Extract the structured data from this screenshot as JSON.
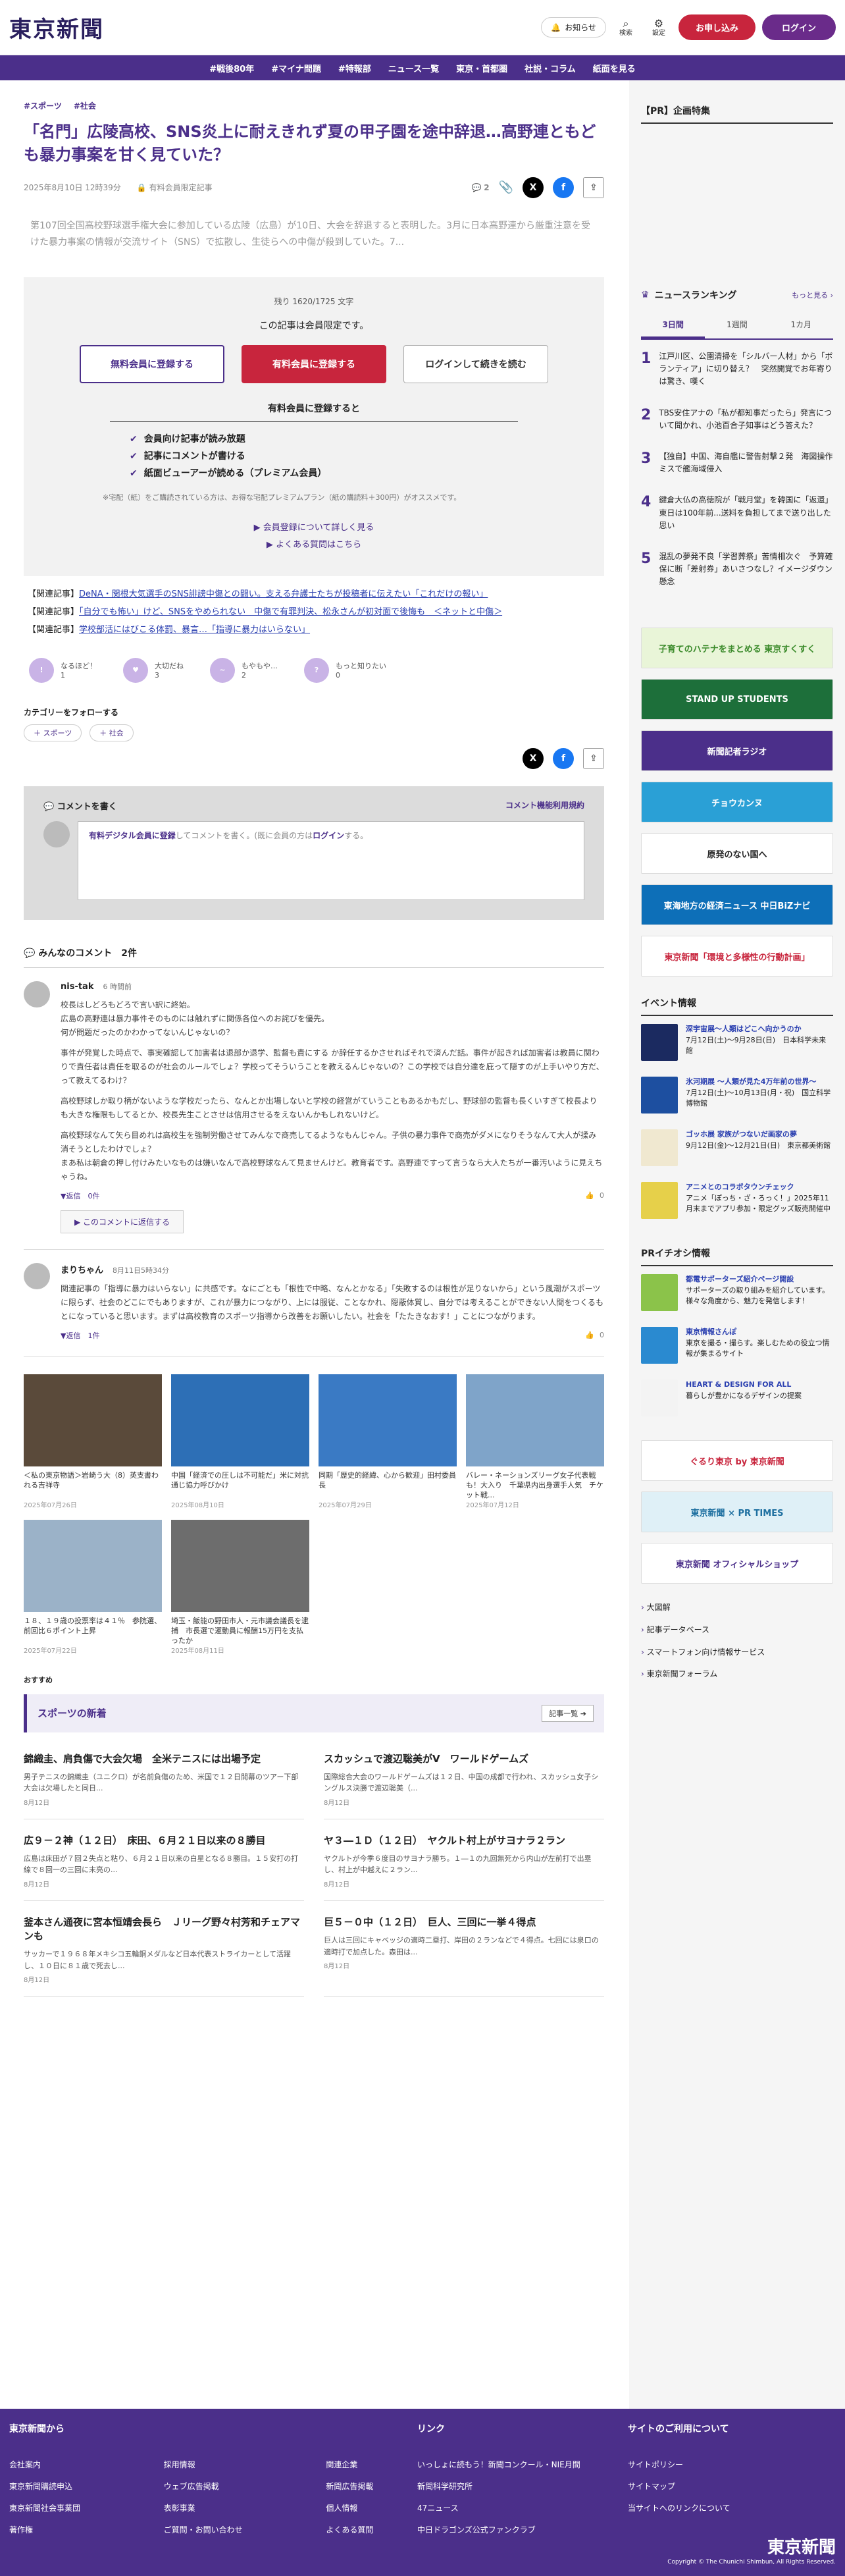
{
  "header": {
    "logo": "東京新聞",
    "notice_label": "お知らせ",
    "search_label": "検索",
    "settings_label": "設定",
    "apply_label": "お申し込み",
    "login_label": "ログイン"
  },
  "nav": [
    "#戦後80年",
    "#マイナ問題",
    "#特報部",
    "ニュース一覧",
    "東京・首都圏",
    "社説・コラム",
    "紙面を見る"
  ],
  "article": {
    "tags": [
      "#スポーツ",
      "#社会"
    ],
    "title": "「名門」広陵高校、SNS炎上に耐えきれず夏の甲子園を途中辞退…高野連ともども暴力事案を甘く見ていた？",
    "date": "2025年8月10日 12時39分",
    "member_label": "有料会員限定記事",
    "comment_count": "2",
    "lead": "第107回全国高校野球選手権大会に参加している広陵（広島）が10日、大会を辞退すると表明した。3月に日本高野連から厳重注意を受けた暴力事案の情報が交流サイト（SNS）で拡散し、生徒らへの中傷が殺到していた。7..."
  },
  "paywall": {
    "remain": "残り 1620/1725 文字",
    "only": "この記事は会員限定です。",
    "free_btn": "無料会員に登録する",
    "paid_btn": "有料会員に登録する",
    "login_btn": "ログインして続きを読む",
    "sub": "有料会員に登録すると",
    "benefits": [
      "会員向け記事が読み放題",
      "記事にコメントが書ける",
      "紙面ビューアーが読める（プレミアム会員）"
    ],
    "note": "※宅配（紙）をご購読されている方は、お得な宅配プレミアムプラン（紙の購読料＋300円）がオススメです。",
    "link1": "会員登録について詳しく見る",
    "link2": "よくある質問はこちら"
  },
  "related": [
    {
      "label": "【関連記事】",
      "text": "DeNA・関根大気選手のSNS誹謗中傷との闘い。支える弁護士たちが投稿者に伝えたい「これだけの報い」"
    },
    {
      "label": "【関連記事】",
      "text": "「自分でも怖い」けど、SNSをやめられない　中傷で有罪判決、松永さんが初対面で後悔も　＜ネットと中傷＞"
    },
    {
      "label": "【関連記事】",
      "text": "学校部活にはびこる体罰、暴言…「指導に暴力はいらない」"
    }
  ],
  "reactions": [
    {
      "label": "なるほど！",
      "count": "1",
      "glyph": "!"
    },
    {
      "label": "大切だね",
      "count": "3",
      "glyph": "♥"
    },
    {
      "label": "もやもや…",
      "count": "2",
      "glyph": "~"
    },
    {
      "label": "もっと知りたい",
      "count": "0",
      "glyph": "?"
    }
  ],
  "follow": {
    "label": "カテゴリーをフォローする",
    "tags": [
      "＋ スポーツ",
      "＋ 社会"
    ]
  },
  "comment_box": {
    "title": "コメントを書く",
    "rules": "コメント機能利用規約",
    "placeholder_pre": "有料デジタル会員に登録",
    "placeholder_mid": "してコメントを書く。(既に会員の方は",
    "placeholder_login": "ログイン",
    "placeholder_end": "する。"
  },
  "comments_header": "みんなのコメント　2件",
  "comments": [
    {
      "name": "nis-tak",
      "time": "6 時間前",
      "paras": [
        "校長はしどろもどろで言い訳に終始。\n広島の高野連は暴力事件そのものには触れずに関係各位へのお詫びを優先。\n何が問題だったのかわかってないんじゃないの？",
        "事件が発覚した時点で、事実確認して加害者は退部か退学、監督も責にする か辞任するかさせればそれで済んだ話。事件が起きれば加害者は教員に関わりで責任者は責任を取るのが社会のルールでしょ？学校ってそういうことを教えるんじゃないの？この学校では自分達を庇って隠すのが上手いやり方だ、って教えてるわけ？",
        "高校野球しか取り柄がないような学校だったら、なんとか出場しないと学校の経営がていうこともあるかもだし、野球部の監督も長くいすぎて校長よりも大きな権限もしてるとか、校長先生ことさせは信用させるをえないんかもしれないけど。",
        "高校野球なんて矢ら目めれは高校生を強制労働させてみんなで商売してるようなもんじゃん。子供の暴力事件で商売がダメになりそうなんて大人が揉み消そうとしたわけでしょ？\nまあ私は朝倉の押し付けみたいなものは嫌いなんで高校野球なんて見ませんけど。教育者です。高野連ですって言うなら大人たちが一番汚いように見えちゃうね。"
      ],
      "replies": "返信　0件",
      "likes": "0",
      "reply_btn": "このコメントに返信する"
    },
    {
      "name": "まりちゃん",
      "time": "8月11日5時34分",
      "paras": [
        "関連記事の「指導に暴力はいらない」に共感です。なにごとも「根性で中略、なんとかなる」「失敗するのは根性が足りないから」という風潮がスポーツに限らず、社会のどこにでもありますが、これが暴力につながり、上には服従、ことなかれ、隠蔽体質し、自分では考えることができない人間をつくるもとになっていると思います。まずは高校教育のスポーツ指導から改善をお願いしたい。社会を「たたきなおす！」ことにつながります。"
      ],
      "replies": "返信　1件",
      "likes": "0"
    }
  ],
  "photos": [
    {
      "cap": "＜私の東京物語＞岩崎う大（8）英支書われる吉祥寺",
      "date": "2025年07月26日",
      "color": "#5a4a3a"
    },
    {
      "cap": "中国「経済での圧しは不可能だ」米に対抗通じ協力呼びかけ",
      "date": "2025年08月10日",
      "color": "#2d6fb6"
    },
    {
      "cap": "同期「歴史的経緯、心から歓迎」田村委員長",
      "date": "2025年07月29日",
      "color": "#3a7ac4"
    },
    {
      "cap": "バレー・ネーションズリーグ女子代表戦も！大入り　千葉県内出身選手人気　チケット戦...",
      "date": "2025年07月12日",
      "color": "#7fa4c9"
    },
    {
      "cap": "１８、１９歳の投票率は４１％　参院選、前回比６ポイント上昇",
      "date": "2025年07月22日",
      "color": "#9bb2c8"
    },
    {
      "cap": "埼玉・飯能の野田市人・元市議会議長を逮捕　市長選で運動員に報酬15万円を支払ったか",
      "date": "2025年08月11日",
      "color": "#6d6d6d"
    }
  ],
  "recommend": "おすすめ",
  "sports": {
    "title": "スポーツの新着",
    "more": "記事一覧",
    "items": [
      {
        "h": "錦織圭、肩負傷で大会欠場　全米テニスには出場予定",
        "p": "男子テニスの錦織圭（ユニクロ）が名前負傷のため、米国で１２日開幕のツアー下部大会は欠場したと同日...",
        "d": "8月12日"
      },
      {
        "h": "スカッシュで渡辺聡美がV　ワールドゲームズ",
        "p": "国際総合大会のワールドゲームズは１２日、中国の成都で行われ、スカッシュ女子シングルス決勝で渡辺聡美（...",
        "d": "8月12日"
      },
      {
        "h": "広９－２神（１２日）　床田、６月２１日以来の８勝目",
        "p": "広島は床田が７回２失点と粘り、６月２１日以来の白星となる８勝目。１５安打の打線で８回一の三回に末亮の...",
        "d": "8月12日"
      },
      {
        "h": "ヤ３―１Ｄ（１２日）　ヤクルト村上がサヨナラ２ラン",
        "p": "ヤクルトが今季６度目のサヨナラ勝ち。１―１の九回無死から内山が左前打で出塁し、村上が中越えに２ラン...",
        "d": "8月12日"
      },
      {
        "h": "釜本さん通夜に宮本恒靖会長ら　Ｊリーグ野々村芳和チェアマンも",
        "p": "サッカーで１９６８年メキシコ五輪銅メダルなど日本代表ストライカーとして活躍し、１０日に８１歳で死去し...",
        "d": "8月12日"
      },
      {
        "h": "巨５－０中（１２日）　巨人、三回に一挙４得点",
        "p": "巨人は三回にキャベッジの適時二塁打、岸田の２ランなどで４得点。七回には泉口の適時打で加点した。森田は...",
        "d": "8月12日"
      }
    ]
  },
  "side": {
    "pr_title": "【PR】企画特集",
    "rank_title": "ニュースランキング",
    "rank_more": "もっと見る",
    "tabs": [
      "3日間",
      "1週間",
      "1カ月"
    ],
    "rank": [
      {
        "n": "1",
        "t": "江戸川区、公園清掃を「シルバー人材」から「ボランティア」に切り替え？　突然開覚でお年寄りは驚き、嘆く"
      },
      {
        "n": "2",
        "t": "TBS安住アナの「私が都知事だったら」発言について聞かれ、小池百合子知事はどう答えた？"
      },
      {
        "n": "3",
        "t": "【独自】中国、海自艦に警告射撃２発　海図操作ミスで艦海域侵入"
      },
      {
        "n": "4",
        "t": "鍵倉大仏の高徳院が「戦月堂」を韓国に「返還」 東日は100年前...送料を負担してまで送り出した思い"
      },
      {
        "n": "5",
        "t": "混乱の夢発不良「学習葬祭」苦情相次ぐ　予算確保に断「差射券」あいさつなし？イメージダウン懸念"
      }
    ],
    "banners": [
      {
        "t": "子育てのハテナをまとめる 東京すくすく",
        "bg": "#e9f5d8",
        "fg": "#3a8a2a"
      },
      {
        "t": "STAND UP STUDENTS",
        "bg": "#1d6f3a",
        "fg": "#fff"
      },
      {
        "t": "新聞記者ラジオ",
        "bg": "#4b2f8a",
        "fg": "#fff"
      },
      {
        "t": "チョウカンヌ",
        "bg": "#2aa0d6",
        "fg": "#fff"
      },
      {
        "t": "原発のない国へ",
        "bg": "#fff",
        "fg": "#222"
      },
      {
        "t": "東海地方の経済ニュース 中日BiZナビ",
        "bg": "#0d6fb8",
        "fg": "#fff"
      },
      {
        "t": "東京新聞「環境と多様性の行動計画」",
        "bg": "#fff",
        "fg": "#c8253d"
      }
    ],
    "event_title": "イベント情報",
    "events": [
      {
        "t": "深宇宙展〜人類はどこへ向かうのか",
        "s": "7月12日(土)〜9月28日(日)　日本科学未来館",
        "color": "#1b2a60"
      },
      {
        "t": "氷河期展 〜人類が見た4万年前の世界〜",
        "s": "7月12日(土)〜10月13日(月・祝)　国立科学博物館",
        "color": "#1d4fa0"
      },
      {
        "t": "ゴッホ展 家族がつないだ画家の夢",
        "s": "9月12日(金)〜12月21日(日)　東京都美術館",
        "color": "#f0e8d0"
      },
      {
        "t": "アニメとのコラボタウンチェック",
        "s": "アニメ「ぽっち・ざ・ろっく！」2025年11月末までアプリ参加・限定グッズ販売開催中",
        "color": "#e6d04a"
      }
    ],
    "pr2_title": "PRイチオシ情報",
    "pr2": [
      {
        "t": "都電サポーターズ紹介ページ開設",
        "s": "サポーターズの取り組みを紹介しています。様々な角度から、魅力を発信します！",
        "color": "#8bc34a"
      },
      {
        "t": "東京情報さんぽ",
        "s": "東京を撮る・撮らす。楽しむための役立つ情報が集まるサイト",
        "color": "#2a8ad0"
      },
      {
        "t": "HEART & DESIGN FOR ALL",
        "s": "暮らしが豊かになるデザインの提案",
        "color": "#f3f3f3"
      }
    ],
    "banners2": [
      {
        "t": "ぐるり東京 by 東京新聞",
        "bg": "#fff",
        "fg": "#c8253d"
      },
      {
        "t": "東京新聞 × PR TIMES",
        "bg": "#dff0f7",
        "fg": "#1d6fa0"
      },
      {
        "t": "東京新聞 オフィシャルショップ",
        "bg": "#fff",
        "fg": "#4b2f8a"
      }
    ],
    "links": [
      "大図解",
      "記事データベース",
      "スマートフォン向け情報サービス",
      "東京新聞フォーラム"
    ]
  },
  "footer": {
    "col1_title": "東京新聞から",
    "col1": [
      "会社案内",
      "東京新聞購読申込",
      "東京新聞社会事業団",
      "著作権",
      "採用情報",
      "ウェブ広告掲載",
      "表彰事業",
      "ご質問・お問い合わせ",
      "関連企業",
      "新聞広告掲載",
      "個人情報",
      "よくある質問"
    ],
    "col2_title": "リンク",
    "col2": [
      "いっしょに読もう！新聞コンクール・NIE月間",
      "新聞科学研究所",
      "47ニュース",
      "中日ドラゴンズ公式ファンクラブ"
    ],
    "col3_title": "サイトのご利用について",
    "col3": [
      "サイトポリシー",
      "サイトマップ",
      "当サイトへのリンクについて"
    ],
    "logo": "東京新聞",
    "copyright": "Copyright © The Chunichi Shimbun, All Rights Reserved."
  }
}
